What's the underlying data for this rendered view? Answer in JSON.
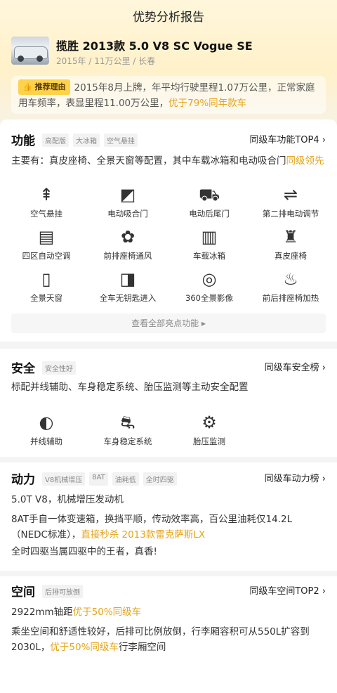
{
  "page": {
    "title": "优势分析报告"
  },
  "car": {
    "name": "揽胜 2013款 5.0 V8 SC Vogue SE",
    "meta": "2015年 / 11万公里 / 长春"
  },
  "recommend": {
    "tag": "推荐理由",
    "text": "2015年8月上牌，年平均行驶里程1.07万公里，正常家庭用车频率，表显里程11.00万公里，",
    "highlight": "优于79%同年款车"
  },
  "function": {
    "title": "功能",
    "tags": [
      "高配版",
      "大冰箱",
      "空气悬挂"
    ],
    "rank": "同级车功能TOP4",
    "summary": "主要有：真皮座椅、全景天窗等配置，其中车载冰箱和电动吸合门",
    "summary_highlight": "同级领先",
    "items": [
      {
        "label": "空气悬挂",
        "icon": "air-suspension-icon",
        "glyph": "⇞"
      },
      {
        "label": "电动吸合门",
        "icon": "soft-close-door-icon",
        "glyph": "◩"
      },
      {
        "label": "电动后尾门",
        "icon": "power-tailgate-icon",
        "glyph": "⛟"
      },
      {
        "label": "第二排电动调节",
        "icon": "seat-adjust-icon",
        "glyph": "⇌"
      },
      {
        "label": "四区自动空调",
        "icon": "climate-icon",
        "glyph": "▤"
      },
      {
        "label": "前排座椅通风",
        "icon": "seat-ventilation-icon",
        "glyph": "✿"
      },
      {
        "label": "车载冰箱",
        "icon": "fridge-icon",
        "glyph": "▥"
      },
      {
        "label": "真皮座椅",
        "icon": "leather-seat-icon",
        "glyph": "♜"
      },
      {
        "label": "全景天窗",
        "icon": "sunroof-icon",
        "glyph": "▯"
      },
      {
        "label": "全车无钥匙进入",
        "icon": "keyless-entry-icon",
        "glyph": "◨"
      },
      {
        "label": "360全景影像",
        "icon": "camera-360-icon",
        "glyph": "◎"
      },
      {
        "label": "前后排座椅加热",
        "icon": "seat-heating-icon",
        "glyph": "♨"
      }
    ],
    "more": "查看全部亮点功能 ▸"
  },
  "safety": {
    "title": "安全",
    "tags": [
      "安全性好"
    ],
    "rank": "同级车安全榜",
    "summary": "标配并线辅助、车身稳定系统、胎压监测等主动安全配置",
    "items": [
      {
        "label": "并线辅助",
        "icon": "lane-assist-icon",
        "glyph": "◐"
      },
      {
        "label": "车身稳定系统",
        "icon": "stability-icon",
        "glyph": "⛐"
      },
      {
        "label": "胎压监测",
        "icon": "tire-pressure-icon",
        "glyph": "⚙"
      }
    ]
  },
  "power": {
    "title": "动力",
    "tags": [
      "V8机械增压",
      "8AT",
      "油耗低",
      "全时四驱"
    ],
    "rank": "同级车动力榜",
    "line1": "5.0T V8，机械增压发动机",
    "line2": "8AT手自一体变速箱，换挡平顺，传动效率高，百公里油耗仅14.2L（NEDC标准），",
    "line2_highlight": "直接秒杀 2013款雷克萨斯LX",
    "line3": "全时四驱当属四驱中的王者，真香!"
  },
  "space": {
    "title": "空间",
    "tags": [
      "后排可放倒"
    ],
    "rank": "同级车空间TOP2",
    "line1": "2922mm轴距",
    "line1_highlight": "优于50%同级车",
    "line2a": "乘坐空间和舒适性较好，后排可比例放倒，行李厢容积可从550L扩容到2030L，",
    "line2_highlight": "优于50%同级车",
    "line2b": "行李厢空间"
  }
}
